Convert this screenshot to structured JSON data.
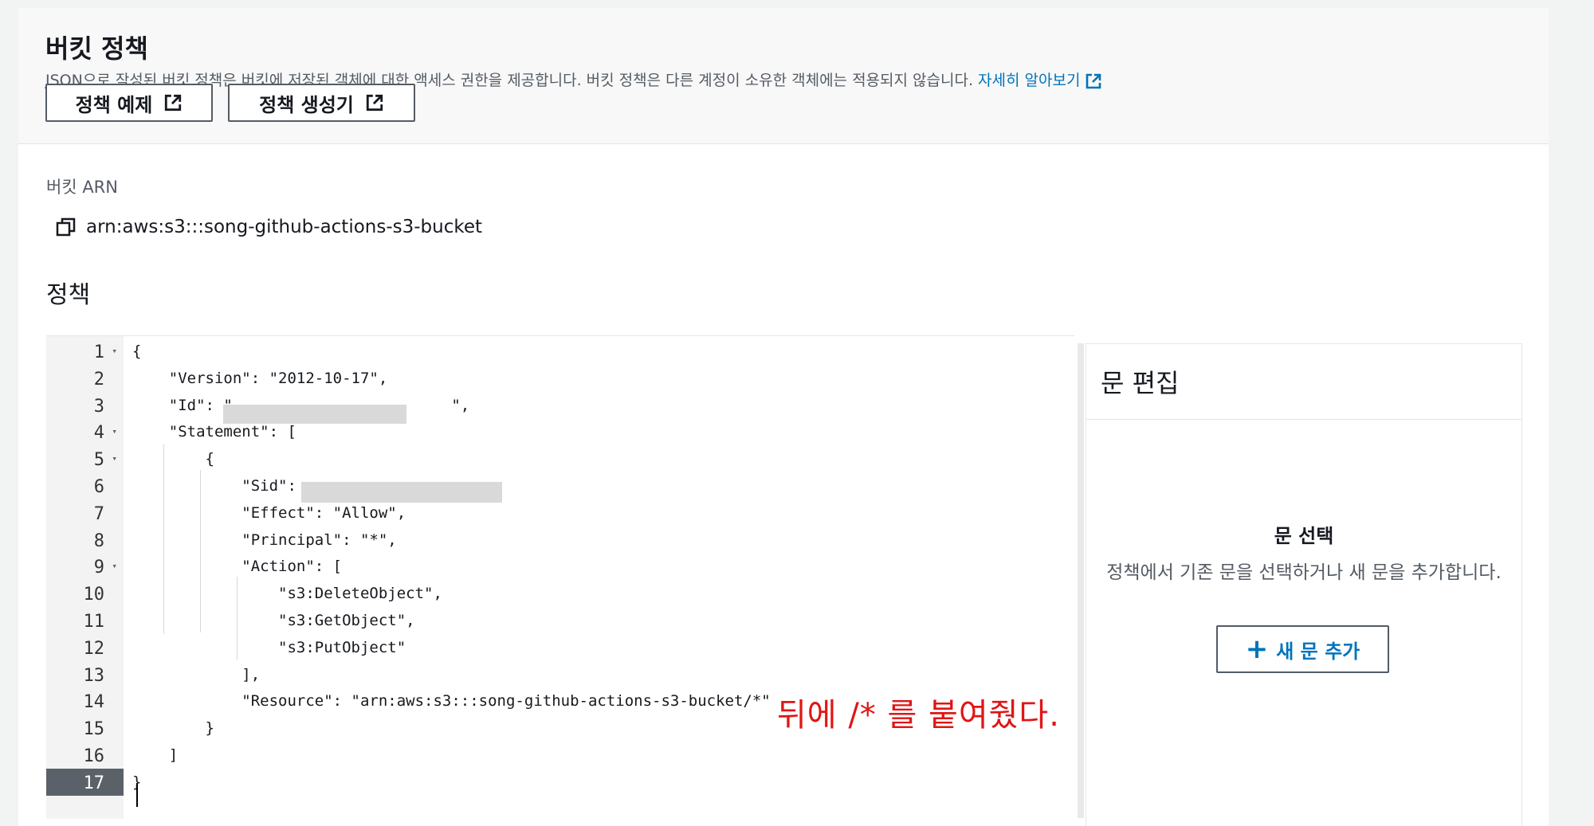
{
  "header": {
    "title": "버킷 정책",
    "description": "JSON으로 작성된 버킷 정책은 버킷에 저장된 객체에 대한 액세스 권한을 제공합니다. 버킷 정책은 다른 계정이 소유한 객체에는 적용되지 않습니다.",
    "learn_more": "자세히 알아보기",
    "buttons": {
      "policy_examples": "정책 예제",
      "policy_generator": "정책 생성기"
    }
  },
  "arn": {
    "label": "버킷 ARN",
    "value": "arn:aws:s3:::song-github-actions-s3-bucket"
  },
  "policy": {
    "label": "정책",
    "lines": [
      {
        "num": "1",
        "fold": true,
        "text": "{"
      },
      {
        "num": "2",
        "fold": false,
        "text": "    \"Version\": \"2012-10-17\","
      },
      {
        "num": "3",
        "fold": false,
        "text": "    \"Id\": \"                        \","
      },
      {
        "num": "4",
        "fold": true,
        "text": "    \"Statement\": ["
      },
      {
        "num": "5",
        "fold": true,
        "text": "        {"
      },
      {
        "num": "6",
        "fold": false,
        "text": "            \"Sid\": "
      },
      {
        "num": "7",
        "fold": false,
        "text": "            \"Effect\": \"Allow\","
      },
      {
        "num": "8",
        "fold": false,
        "text": "            \"Principal\": \"*\","
      },
      {
        "num": "9",
        "fold": true,
        "text": "            \"Action\": ["
      },
      {
        "num": "10",
        "fold": false,
        "text": "                \"s3:DeleteObject\","
      },
      {
        "num": "11",
        "fold": false,
        "text": "                \"s3:GetObject\","
      },
      {
        "num": "12",
        "fold": false,
        "text": "                \"s3:PutObject\""
      },
      {
        "num": "13",
        "fold": false,
        "text": "            ],"
      },
      {
        "num": "14",
        "fold": false,
        "text": "            \"Resource\": \"arn:aws:s3:::song-github-actions-s3-bucket/*\""
      },
      {
        "num": "15",
        "fold": false,
        "text": "        }"
      },
      {
        "num": "16",
        "fold": false,
        "text": "    ]"
      },
      {
        "num": "17",
        "fold": false,
        "text": "}"
      }
    ],
    "active_line": "17",
    "annotation": "뒤에 /* 를 붙여줬다."
  },
  "side_panel": {
    "title": "문 편집",
    "select_title": "문 선택",
    "select_desc": "정책에서 기존 문을 선택하거나 새 문을 추가합니다.",
    "add_button": "새 문 추가",
    "add_icon": "plus-icon"
  },
  "colors": {
    "accent": "#0073bb",
    "annotation": "#e01515"
  }
}
